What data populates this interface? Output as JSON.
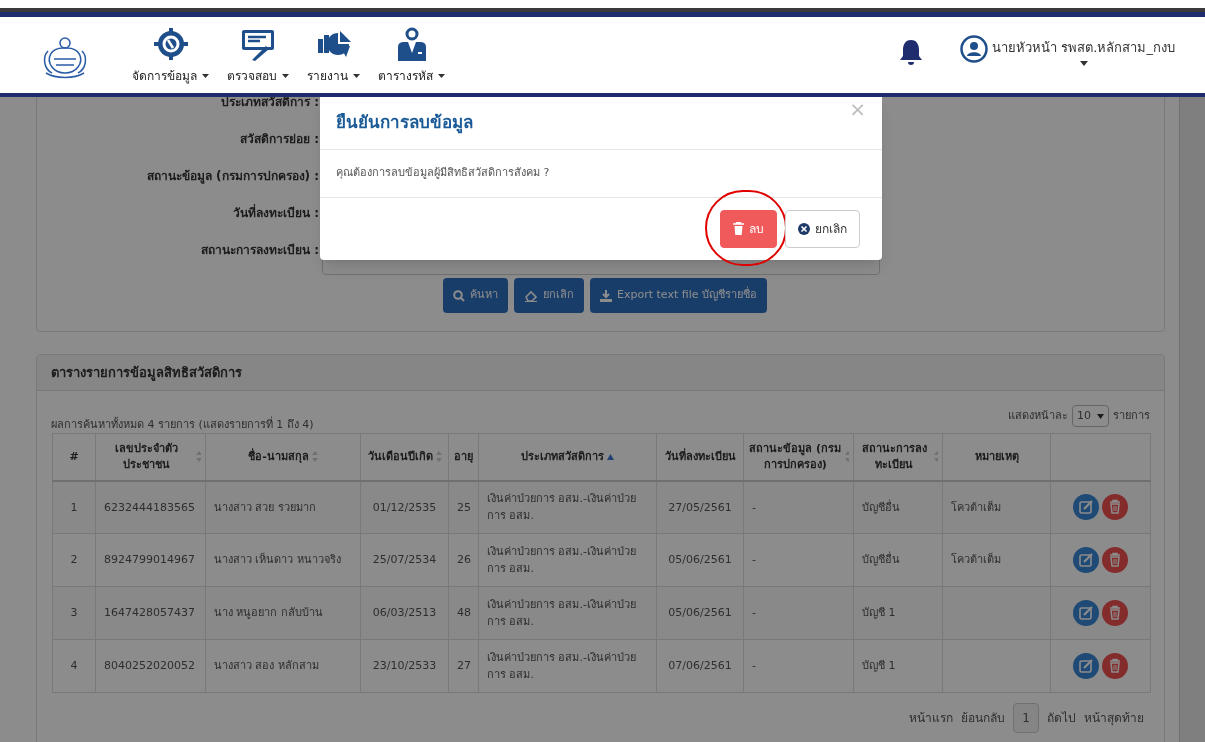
{
  "nav_menu": [
    {
      "label": "จัดการข้อมูล",
      "kind": "settings"
    },
    {
      "label": "ตรวจสอบ",
      "kind": "review"
    },
    {
      "label": "รายงาน",
      "kind": "report"
    },
    {
      "label": "ตารางรหัส",
      "kind": "codes"
    }
  ],
  "user": {
    "name": "นายหัวหน้า รพสต.หลักสาม_กงบ"
  },
  "search_form": {
    "labels": [
      "ประเภทสวัสดิการ :",
      "สวัสดิการย่อย :",
      "สถานะข้อมูล (กรมการปกครอง) :",
      "วันที่ลงทะเบียน :",
      "สถานะการลงทะเบียน :"
    ],
    "buttons": [
      {
        "label": "ค้นหา",
        "kind": "search"
      },
      {
        "label": "ยกเลิก",
        "kind": "clear"
      },
      {
        "label": "Export text file บัญชีรายชื่อ",
        "kind": "export"
      }
    ]
  },
  "results": {
    "title": "ตารางรายการข้อมูลสิทธิสวัสดิการ",
    "summary": "ผลการค้นหาทั้งหมด 4 รายการ (แสดงรายการที่ 1 ถึง 4)",
    "page_size_label": "แสดงหน้าละ",
    "page_size": "10",
    "page_size_unit": "รายการ",
    "columns": [
      {
        "label": "#",
        "sortable": false,
        "sorted": false
      },
      {
        "label": "เลขประจำตัว ประชาชน",
        "sortable": true,
        "sorted": false
      },
      {
        "label": "ชื่อ-นามสกุล",
        "sortable": true,
        "sorted": false
      },
      {
        "label": "วันเดือนปีเกิด",
        "sortable": true,
        "sorted": false
      },
      {
        "label": "อายุ",
        "sortable": false,
        "sorted": false
      },
      {
        "label": "ประเภทสวัสดิการ",
        "sortable": true,
        "sorted": true
      },
      {
        "label": "วันที่ลงทะเบียน",
        "sortable": false,
        "sorted": false
      },
      {
        "label": "สถานะข้อมูล (กรมการปกครอง)",
        "sortable": true,
        "sorted": false
      },
      {
        "label": "สถานะการลง ทะเบียน",
        "sortable": true,
        "sorted": false
      },
      {
        "label": "หมายเหตุ",
        "sortable": false,
        "sorted": false
      }
    ],
    "rows": [
      {
        "cells": [
          "1",
          "6232444183565",
          "นางสาว สวย รวยมาก",
          "01/12/2535",
          "25",
          "เงินค่าป่วยการ อสม.-เงินค่าป่วยการ อสม.",
          "27/05/2561",
          "-",
          "บัญชีอื่น",
          "โควต้าเต็ม"
        ]
      },
      {
        "cells": [
          "2",
          "8924799014967",
          "นางสาว เห็นดาว หนาวจริง",
          "25/07/2534",
          "26",
          "เงินค่าป่วยการ อสม.-เงินค่าป่วยการ อสม.",
          "05/06/2561",
          "-",
          "บัญชีอื่น",
          "โควต้าเต็ม"
        ]
      },
      {
        "cells": [
          "3",
          "1647428057437",
          "นาง หนูอยาก กลับบ้าน",
          "06/03/2513",
          "48",
          "เงินค่าป่วยการ อสม.-เงินค่าป่วยการ อสม.",
          "05/06/2561",
          "-",
          "บัญชี 1",
          ""
        ]
      },
      {
        "cells": [
          "4",
          "8040252020052",
          "นางสาว สอง หลักสาม",
          "23/10/2533",
          "27",
          "เงินค่าป่วยการ อสม.-เงินค่าป่วยการ อสม.",
          "07/06/2561",
          "-",
          "บัญชี 1",
          ""
        ]
      }
    ],
    "pagination": {
      "first": "หน้าแรก",
      "prev": "ย้อนกลับ",
      "page": "1",
      "next": "ถัดไป",
      "last": "หน้าสุดท้าย"
    }
  },
  "dialog": {
    "title": "ยืนยันการลบข้อมูล",
    "close": "×",
    "message": "คุณต้องการลบข้อมูลผู้มีสิทธิสวัสดิการสังคม ?",
    "buttons": [
      {
        "label": "ลบ",
        "kind": "delete",
        "circled": true
      },
      {
        "label": "ยกเลิก",
        "kind": "cancel",
        "circled": false
      }
    ]
  }
}
